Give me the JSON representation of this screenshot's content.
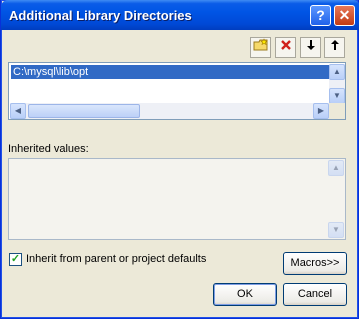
{
  "window": {
    "title": "Additional Library Directories"
  },
  "titlebar": {
    "help_label": "?",
    "close_label": "✕"
  },
  "toolbar": {
    "new_folder_icon": "new-folder-icon",
    "delete_icon": "delete-icon",
    "move_down_icon": "move-down-icon",
    "move_up_icon": "move-up-icon"
  },
  "directories": {
    "items": [
      "C:\\mysql\\lib\\opt"
    ]
  },
  "inherited": {
    "label": "Inherited values:"
  },
  "checkbox": {
    "label": "Inherit from parent or project defaults",
    "checked": true
  },
  "buttons": {
    "macros": "Macros>>",
    "ok": "OK",
    "cancel": "Cancel"
  }
}
